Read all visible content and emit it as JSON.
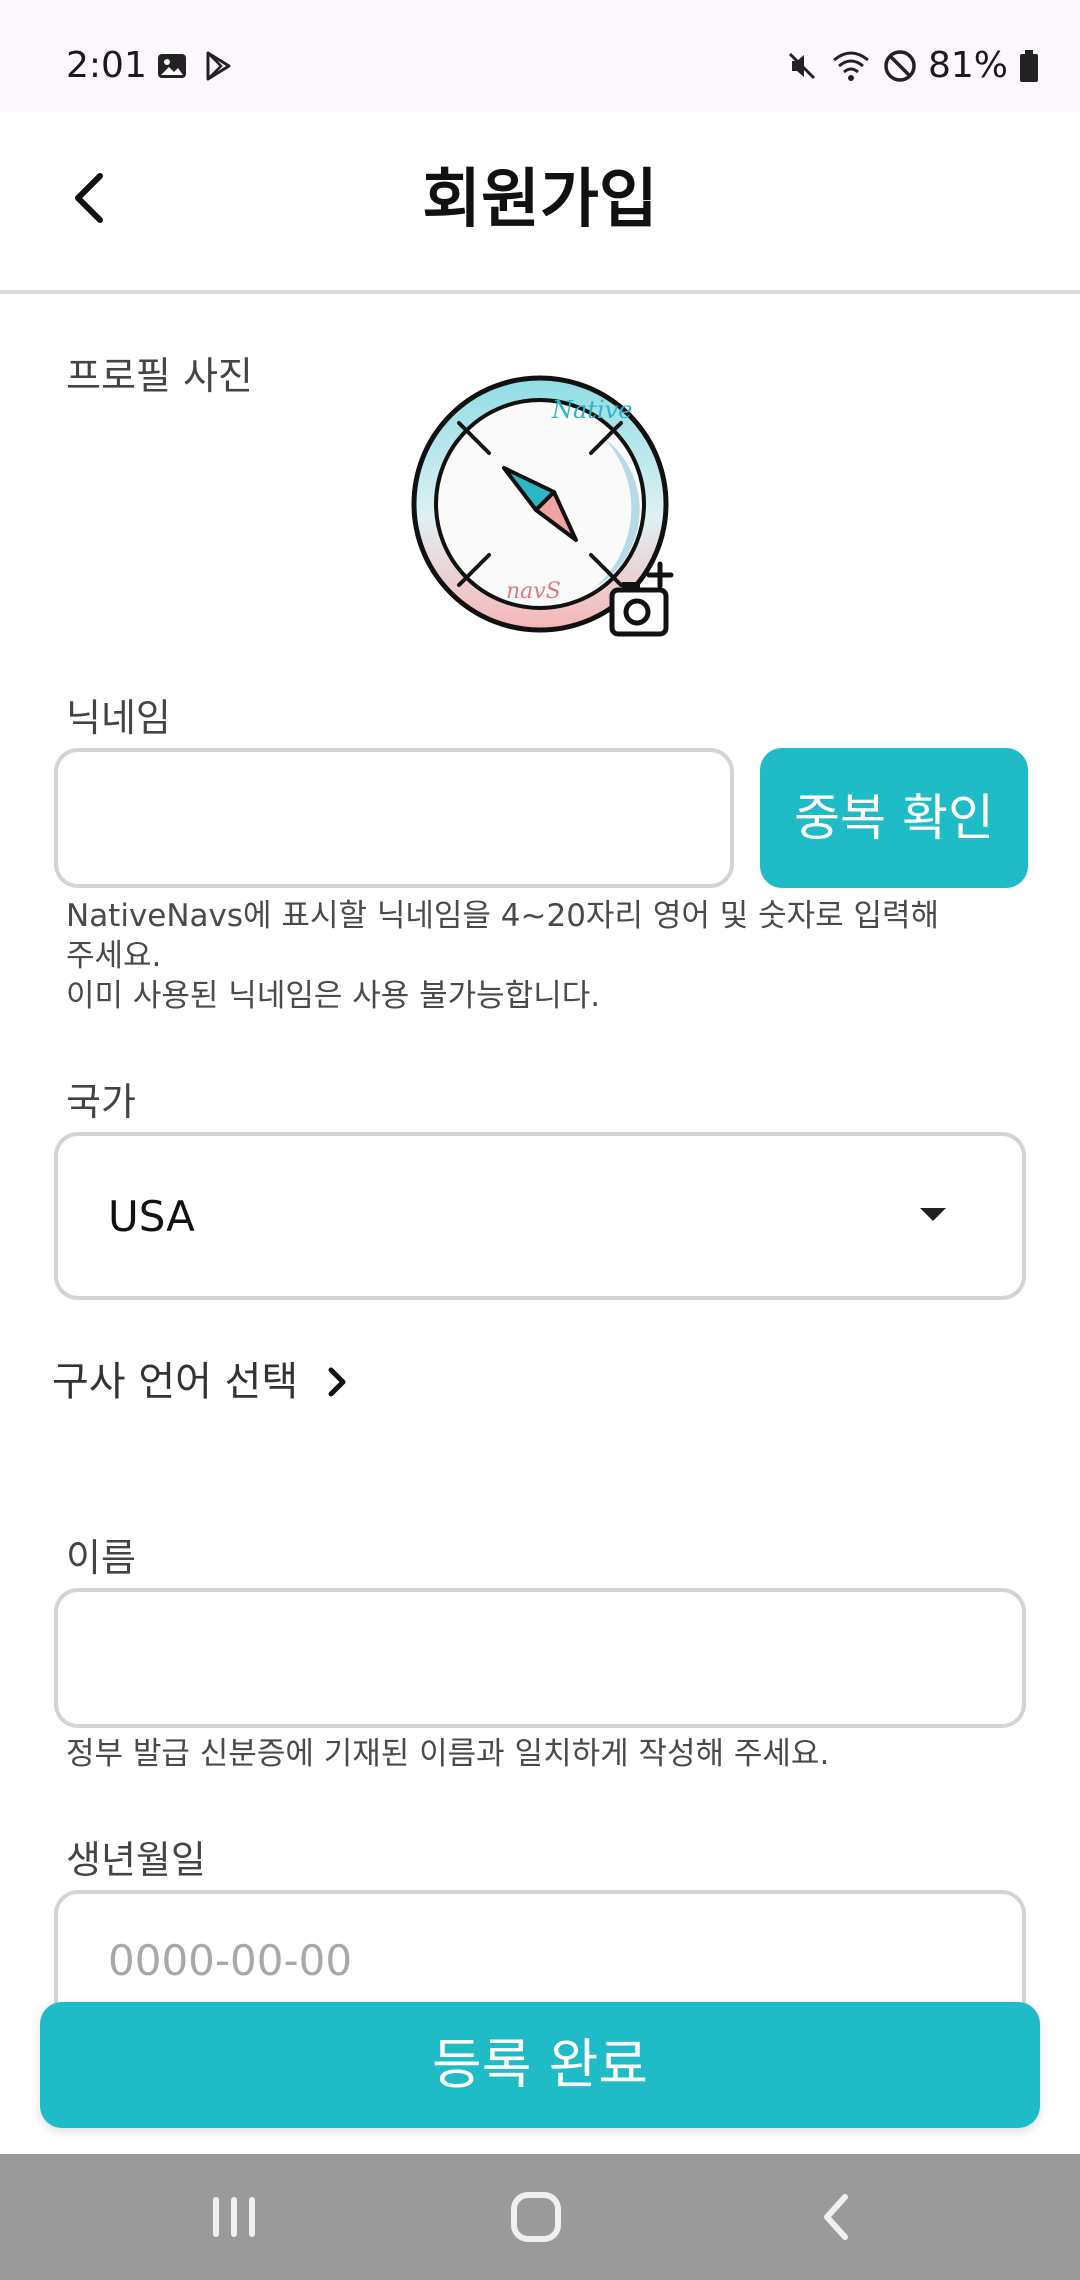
{
  "status_bar": {
    "time": "2:01",
    "battery": "81%",
    "left_icons": [
      "image-icon",
      "play-store-icon"
    ],
    "right_icons": [
      "mute-icon",
      "wifi-icon",
      "do-not-disturb-icon",
      "battery-icon"
    ]
  },
  "header": {
    "title": "회원가입",
    "back_icon": "chevron-left-icon"
  },
  "profile": {
    "label": "프로필 사진",
    "avatar_text_top": "Native",
    "avatar_text_bottom": "navS"
  },
  "nickname": {
    "label": "닉네임",
    "value": "",
    "check_button": "중복 확인",
    "helper_line1": "NativeNavs에 표시할 닉네임을 4~20자리 영어 및 숫자로 입력해",
    "helper_line2": "주세요.",
    "helper_line3": "이미 사용된 닉네임은 사용 불가능합니다."
  },
  "country": {
    "label": "국가",
    "selected": "USA"
  },
  "language": {
    "label": "구사 언어 선택"
  },
  "name": {
    "label": "이름",
    "value": "",
    "helper": "정부 발급 신분증에 기재된 이름과 일치하게 작성해 주세요."
  },
  "birthdate": {
    "label": "생년월일",
    "placeholder": "0000-00-00"
  },
  "submit": {
    "label": "등록 완료"
  },
  "colors": {
    "accent": "#1fbcc8",
    "border": "#d4d4d4",
    "nav_bar": "#9a9a9a",
    "status_bg": "#fcf7fc"
  }
}
